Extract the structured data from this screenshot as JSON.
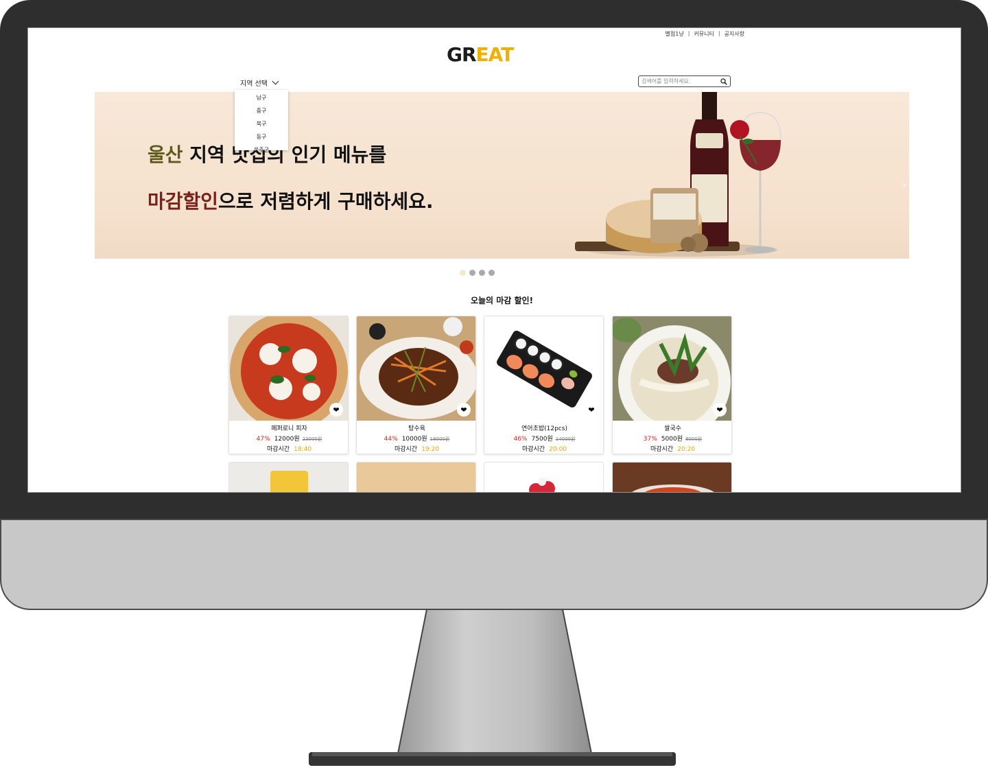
{
  "header": {
    "top_links": [
      "별점1냥",
      "커뮤니티",
      "공지사항"
    ],
    "logo_part1": "GR",
    "logo_part2": "EAT",
    "region_label": "지역 선택",
    "region_options": [
      "남구",
      "중구",
      "북구",
      "동구",
      "울주군"
    ],
    "search_placeholder": "검색어를 입력하세요."
  },
  "banner": {
    "line1_highlight": "울산",
    "line1_rest": " 지역 맛집의 인기 메뉴를",
    "line2_highlight": "마감할인",
    "line2_rest": "으로 저렴하게 구매하세요.",
    "next_arrow": "›",
    "slide_count": 4,
    "active_slide": 1
  },
  "section": {
    "title": "오늘의 마감 할인!",
    "close_label": "마감시간"
  },
  "products": [
    {
      "name": "페퍼로니 피자",
      "discount": "47%",
      "price": "12000원",
      "original_price": "23000원",
      "close_time": "18:40"
    },
    {
      "name": "탕수육",
      "discount": "44%",
      "price": "10000원",
      "original_price": "18000원",
      "close_time": "19:20"
    },
    {
      "name": "연어초밥(12pcs)",
      "discount": "46%",
      "price": "7500원",
      "original_price": "14000원",
      "close_time": "20:00"
    },
    {
      "name": "쌀국수",
      "discount": "37%",
      "price": "5000원",
      "original_price": "8000원",
      "close_time": "20:20"
    }
  ],
  "colors": {
    "logo_accent": "#f0b000",
    "discount": "#e0201a",
    "close_time": "#f0a500",
    "highlight_olive": "#5e5a1e",
    "highlight_red": "#7a1f1a"
  },
  "icons": [
    "search-icon",
    "chevron-down-icon",
    "heart-icon",
    "chevron-right-icon"
  ]
}
